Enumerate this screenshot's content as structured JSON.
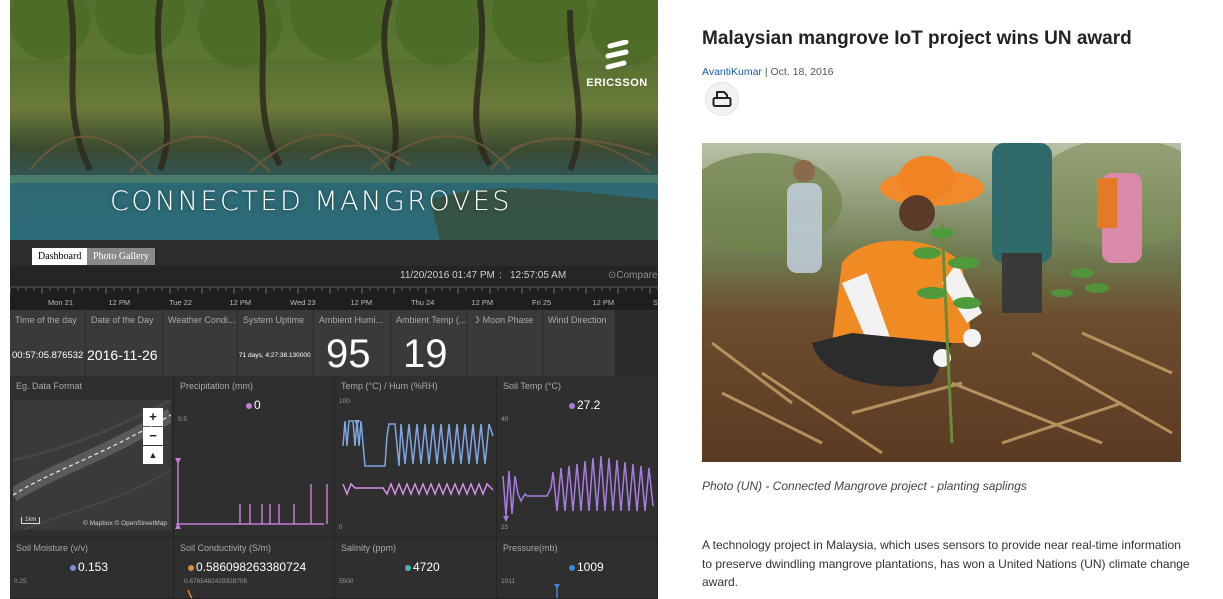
{
  "dashboard": {
    "hero_title": "CONNECTED MANGROVES",
    "brand": "ERICSSON",
    "tabs": [
      {
        "label": "Dashboard",
        "active": true
      },
      {
        "label": "Photo Gallery",
        "active": false
      }
    ],
    "timebar": {
      "date_time": "11/20/2016 01:47 PM",
      "sep1": ":",
      "clock": "12:57:05 AM",
      "compare": "Compare"
    },
    "timeline_labels": [
      "Mon 21",
      "12 PM",
      "Tue 22",
      "12 PM",
      "Wed 23",
      "12 PM",
      "Thu 24",
      "12 PM",
      "Fri 25",
      "12 PM",
      "Sat"
    ],
    "stats": [
      {
        "label": "Time of the day",
        "value": "00:57:05.876532"
      },
      {
        "label": "Date of the Day",
        "value": "2016-11-26"
      },
      {
        "label": "Weather Condi...",
        "value": ""
      },
      {
        "label": "System Uptime",
        "value": "71 days, 4:27:38.130000"
      },
      {
        "label": "Ambient Humi...",
        "value": "95"
      },
      {
        "label": "Ambient Temp (...",
        "value": "19"
      },
      {
        "label": "Moon Phase",
        "value": ""
      },
      {
        "label": "Wind Direction",
        "value": ""
      }
    ],
    "map_panel": {
      "label": "Eg. Data Format",
      "attribution": "© Mapbox © OpenStreetMap",
      "scale": "1km",
      "zoom_in": "+",
      "zoom_out": "−",
      "locate": "▲"
    },
    "panels_row1": [
      {
        "label": "Precipitation (mm)",
        "value": "0",
        "color": "#c77dd9",
        "axis_top": "0.5",
        "axis_bottom": ""
      },
      {
        "label": "Temp (°C) / Hum (%RH)",
        "value": "",
        "color": "#7fa6e0",
        "axis_top": "100",
        "axis_bottom": "0"
      },
      {
        "label": "Soil Temp (°C)",
        "value": "27.2",
        "color": "#a87be0",
        "axis_top": "40",
        "axis_bottom": "25"
      }
    ],
    "panels_row2": [
      {
        "label": "Soil Moisture (v/v)",
        "value": "0.153",
        "color": "#7b8fe0",
        "axis_top": "0.25"
      },
      {
        "label": "Soil Conductivity (S/m)",
        "value": "0.586098263380724",
        "color": "#e08a3a",
        "axis_top": "0.6765482429328705"
      },
      {
        "label": "Salinity (ppm)",
        "value": "4720",
        "color": "#4fb1b0",
        "axis_top": "5500"
      },
      {
        "label": "Pressure(mb)",
        "value": "1009",
        "color": "#3a8ad8",
        "axis_top": "1011"
      }
    ]
  },
  "article": {
    "headline": "Malaysian mangrove IoT project wins UN award",
    "author": "AvantiKumar",
    "byline_sep": " | ",
    "date": "Oct. 18, 2016",
    "caption": "Photo (UN) - Connected Mangrove project - planting saplings",
    "body": "A technology project in Malaysia, which uses sensors to provide near real-time information to preserve dwindling mangrove plantations, has won a United Nations (UN) climate change award."
  }
}
